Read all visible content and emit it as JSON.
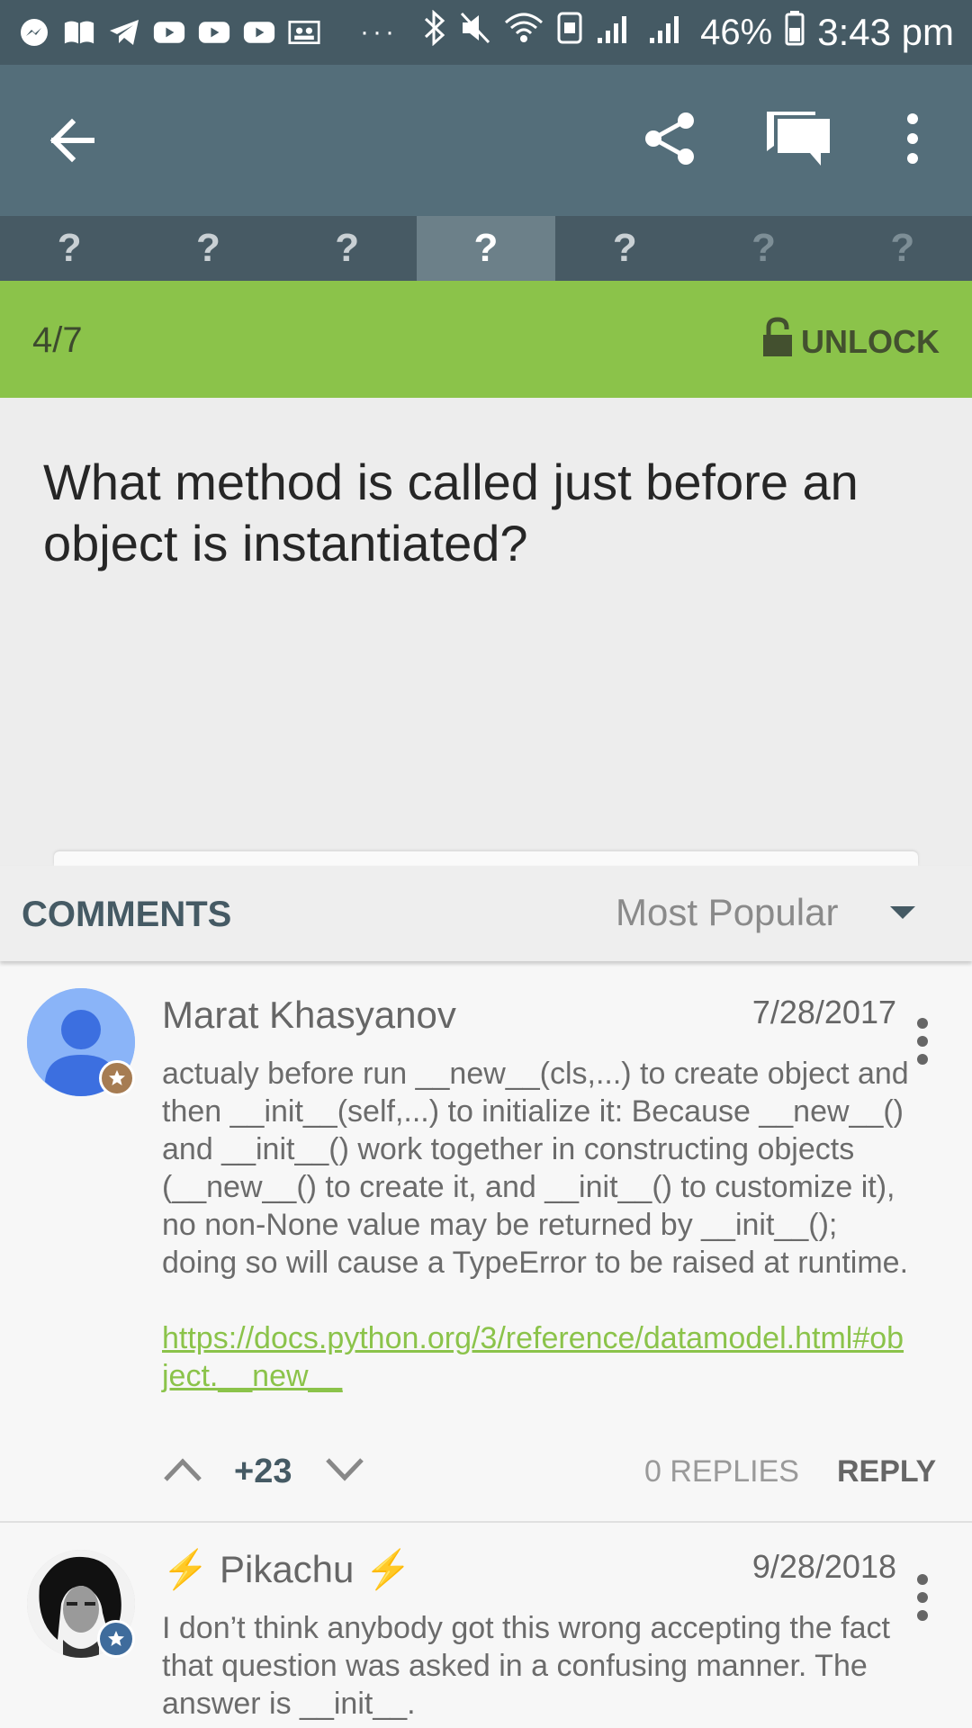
{
  "status_bar": {
    "battery_percent": "46%",
    "time": "3:43 pm",
    "overflow": "···"
  },
  "question_tabs": [
    "?",
    "?",
    "?",
    "?",
    "?",
    "?",
    "?"
  ],
  "progress": {
    "count": "4/7",
    "unlock_label": "UNLOCK"
  },
  "question": {
    "text": "What method is called just before an object is instantiated?"
  },
  "comments_section": {
    "title": "COMMENTS",
    "sort_label": "Most Popular"
  },
  "comments": [
    {
      "author": "Marat Khasyanov",
      "date": "7/28/2017",
      "text": "actualy before run __new__(cls,...) to create object and then __init__(self,...) to initialize it: Because __new__() and __init__() work together in constructing objects (__new__() to create it, and __init__() to customize it), no non-None value may be returned by __init__(); doing so will cause a TypeError to be raised at runtime.",
      "link": "https://docs.python.org/3/reference/datamodel.html#object.__new__",
      "score": "+23",
      "replies": "0 REPLIES",
      "reply_label": "REPLY"
    },
    {
      "author": "Pikachu",
      "author_decoration": "⚡",
      "date": "9/28/2018",
      "text": "I don’t think anybody got this wrong accepting the fact that question was asked in a confusing manner. The answer is __init__."
    }
  ],
  "colors": {
    "app_bar": "#546e7a",
    "status_bar": "#455a64",
    "accent_green": "#8bc34a"
  }
}
